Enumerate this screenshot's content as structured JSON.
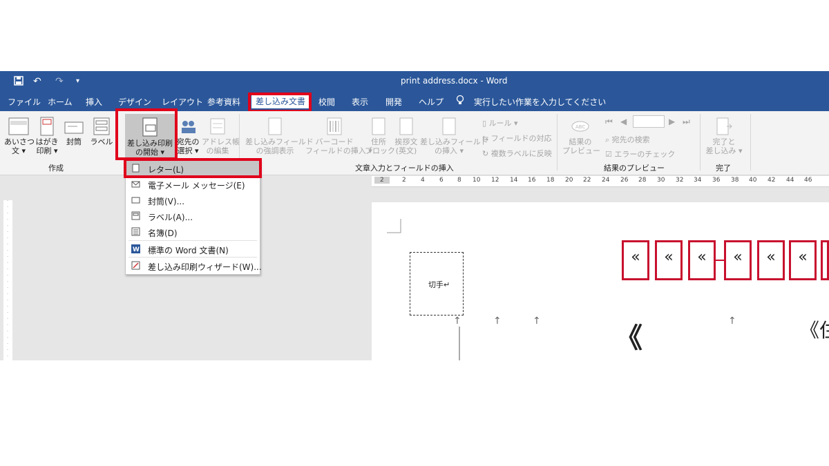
{
  "window": {
    "title": "print address.docx  -  Word"
  },
  "quick_access": {
    "save_icon": "save-icon",
    "undo": "↶",
    "redo": "↷",
    "customize": "▾"
  },
  "tabs": [
    {
      "label": "ファイル"
    },
    {
      "label": "ホーム"
    },
    {
      "label": "挿入"
    },
    {
      "label": "デザイン"
    },
    {
      "label": "レイアウト"
    },
    {
      "label": "参考資料"
    },
    {
      "label": "差し込み文書"
    },
    {
      "label": "校閲"
    },
    {
      "label": "表示"
    },
    {
      "label": "開発"
    },
    {
      "label": "ヘルプ"
    }
  ],
  "tell_me": {
    "placeholder": "実行したい作業を入力してください"
  },
  "ribbon": {
    "create": {
      "greeting_line1": "あいさつ",
      "greeting_line2": "文 ▾",
      "postcard_line1": "はがき",
      "postcard_line2": "印刷 ▾",
      "envelope": "封筒",
      "label": "ラベル",
      "group": "作成"
    },
    "start_merge": {
      "start_line1": "差し込み印刷",
      "start_line2": "の開始 ▾",
      "recipients_line1": "宛先の",
      "recipients_line2": "選択 ▾",
      "edit_list_line1": "アドレス帳",
      "edit_list_line2": "の編集"
    },
    "fields": {
      "highlight_line1": "差し込みフィールド",
      "highlight_line2": "の強調表示",
      "barcode_line1": "バーコード",
      "barcode_line2": "フィールドの挿入 ▾",
      "address_line1": "住所",
      "address_line2": "ブロック",
      "greeting_line1": "挨拶文",
      "greeting_line2": "(英文)",
      "insert_line1": "差し込みフィールド",
      "insert_line2": "の挿入 ▾",
      "rules": "ルール ▾",
      "match": "フィールドの対応",
      "update": "複数ラベルに反映",
      "group": "文章入力とフィールドの挿入"
    },
    "preview": {
      "preview_line1": "結果の",
      "preview_line2": "プレビュー",
      "find": "宛先の検索",
      "check": "エラーのチェック",
      "group": "結果のプレビュー"
    },
    "finish": {
      "finish_line1": "完了と",
      "finish_line2": "差し込み ▾",
      "group": "完了"
    }
  },
  "dropdown": {
    "items": [
      {
        "label": "レター(L)"
      },
      {
        "label": "電子メール メッセージ(E)"
      },
      {
        "label": "封筒(V)..."
      },
      {
        "label": "ラベル(A)..."
      },
      {
        "label": "名簿(D)"
      },
      {
        "label": "標準の Word 文書(N)"
      },
      {
        "label": "差し込み印刷ウィザード(W)..."
      }
    ]
  },
  "ruler": {
    "ticks": [
      "2",
      "2",
      "4",
      "6",
      "8",
      "10",
      "12",
      "14",
      "16",
      "18",
      "20",
      "22",
      "24",
      "26",
      "28",
      "30",
      "32",
      "34",
      "36",
      "38",
      "40",
      "42",
      "44",
      "46"
    ]
  },
  "document": {
    "stamp_label": "切手↵",
    "merge_glyph": "«",
    "name_glyph": "《",
    "address_glyph": "《住"
  },
  "colors": {
    "accent": "#2b579a",
    "highlight": "#e0001b",
    "merge_border": "#c8102e"
  }
}
